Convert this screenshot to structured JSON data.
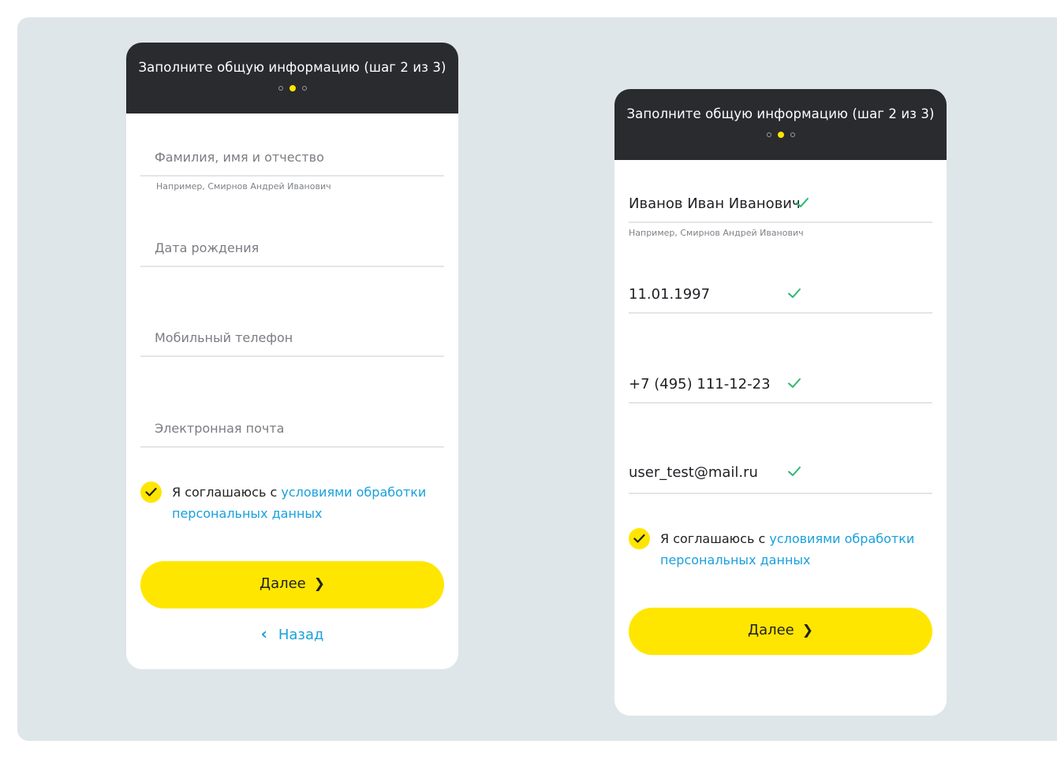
{
  "left_card": {
    "header_title": "Заполните общую информацию (шаг 2 из 3)",
    "fields": [
      {
        "placeholder": "Фамилия, имя и отчество",
        "hint": "Например, Смирнов Андрей Иванович"
      },
      {
        "placeholder": "Дата рождения"
      },
      {
        "placeholder": "Мобильный телефон"
      },
      {
        "placeholder": "Электронная почта"
      }
    ],
    "agree_prefix": "Я соглашаюсь с ",
    "agree_link": "условиями обработки персональных данных",
    "next_label": "Далее",
    "back_label": "Назад"
  },
  "right_card": {
    "header_title": "Заполните общую информацию (шаг 2 из 3)",
    "fields": [
      {
        "value": "Иванов Иван Иванович",
        "hint": "Например, Смирнов Андрей Иванович"
      },
      {
        "value": "11.01.1997"
      },
      {
        "value": "+7 (495) 111-12-23"
      },
      {
        "value": "user_test@mail.ru"
      }
    ],
    "agree_prefix": "Я соглашаюсь с ",
    "agree_link": "условиями обработки персональных данных",
    "next_label": "Далее"
  },
  "step_indicator": {
    "current": 2,
    "total": 3
  },
  "colors": {
    "accent_yellow": "#ffe600",
    "header_dark": "#2a2b2f",
    "link_blue": "#19a0dc",
    "check_green": "#2bb673",
    "background": "#dfe6e9"
  },
  "icons": {
    "next": "chevron-right-icon",
    "back": "chevron-left-icon",
    "valid": "checkmark-icon",
    "agree": "checkbox-checked-icon"
  }
}
